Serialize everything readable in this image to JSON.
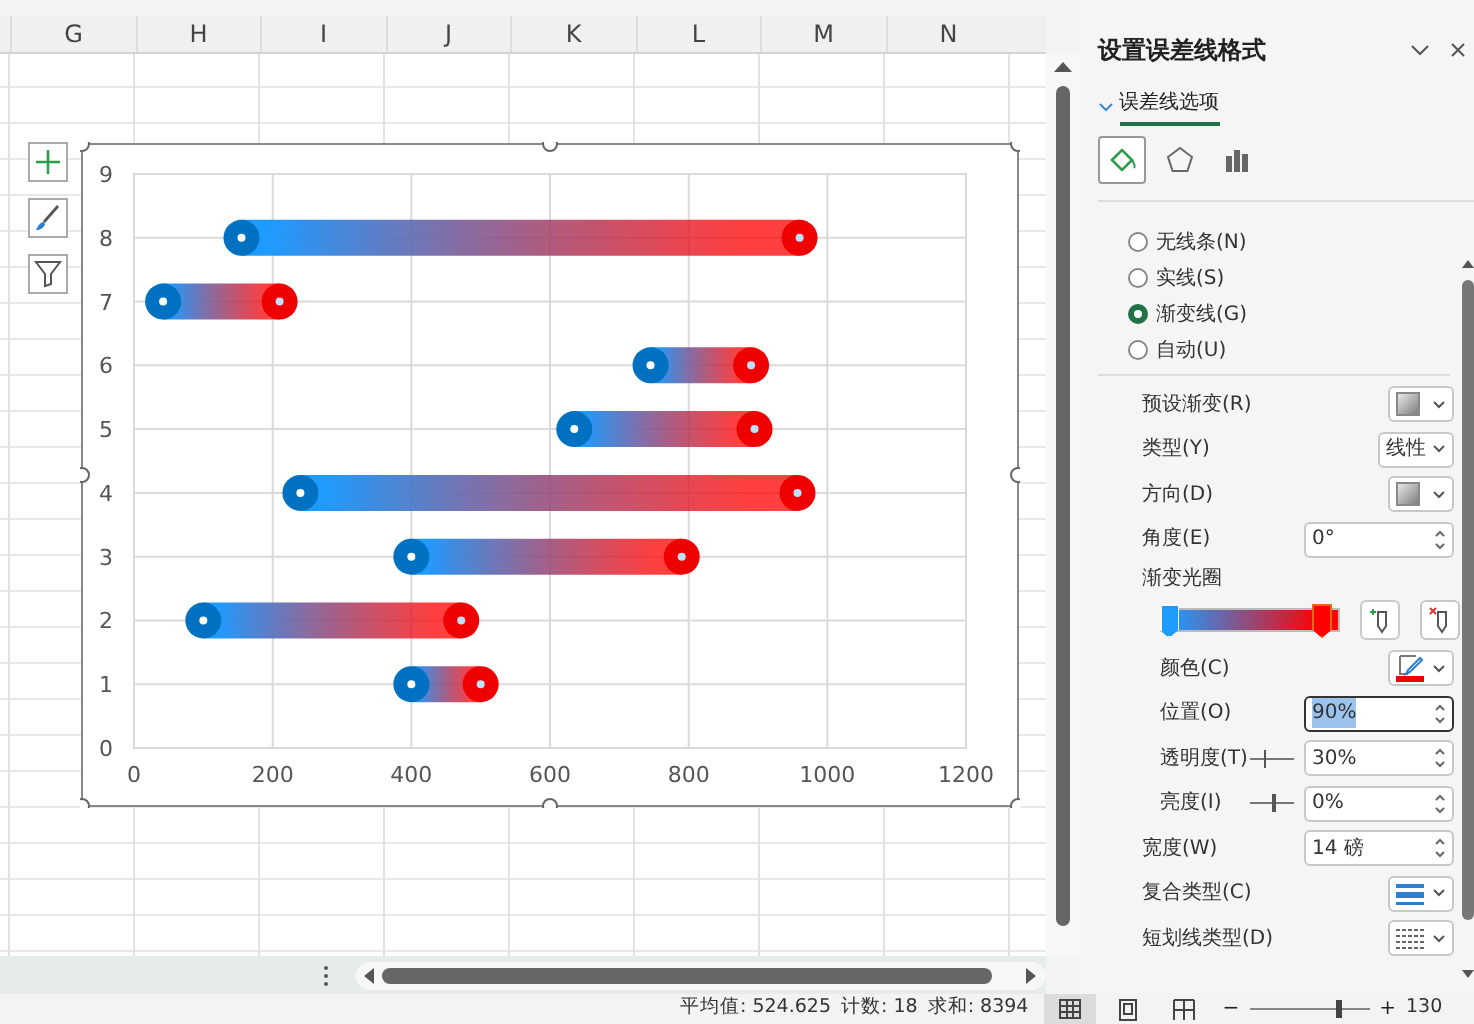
{
  "sheet": {
    "columns": [
      "G",
      "H",
      "I",
      "J",
      "K",
      "L",
      "M",
      "N"
    ]
  },
  "chart": {
    "chart_data": {
      "type": "scatter",
      "orientation": "horizontal",
      "grid": true,
      "x": [
        8,
        7,
        6,
        5,
        4,
        3,
        2,
        1
      ],
      "series": [
        {
          "color": "#0070c0",
          "values": [
            155,
            42,
            745,
            635,
            240,
            400,
            100,
            400
          ],
          "errors": [
            805,
            168,
            145,
            260,
            717,
            390,
            372,
            100
          ]
        },
        {
          "color": "#ee0000",
          "values": [
            960,
            210,
            890,
            895,
            957,
            790,
            472,
            500
          ]
        }
      ],
      "xlim": [
        0,
        1200
      ],
      "ylim": [
        0,
        9
      ],
      "xticks": [
        0,
        200,
        400,
        600,
        800,
        1000,
        1200
      ],
      "yticks": [
        0,
        1,
        2,
        3,
        4,
        5,
        6,
        7,
        8,
        9
      ]
    }
  },
  "pane": {
    "title": "设置误差线格式",
    "section": {
      "label": "误差线选项",
      "expanded": true
    },
    "icon_tabs": [
      {
        "kind": "fill",
        "selected": true
      },
      {
        "kind": "effects",
        "selected": false
      },
      {
        "kind": "options",
        "selected": false
      }
    ],
    "line_options": [
      {
        "label": "无线条(N)",
        "selected": false
      },
      {
        "label": "实线(S)",
        "selected": false
      },
      {
        "label": "渐变线(G)",
        "selected": true
      },
      {
        "label": "自动(U)",
        "selected": false
      }
    ],
    "rows": [
      {
        "kind": "swatch",
        "label": "预设渐变(R)"
      },
      {
        "kind": "select",
        "label": "类型(Y)",
        "value": "线性"
      },
      {
        "kind": "swatch",
        "label": "方向(D)"
      },
      {
        "kind": "spinner",
        "label": "角度(E)",
        "value": "0°",
        "selected": false
      },
      {
        "kind": "heading",
        "label": "渐变光圈",
        "children": [
          {
            "kind": "stops",
            "stops": [
              {
                "level": 0.05,
                "color": "#1e9bff",
                "selected": false
              },
              {
                "level": 0.9,
                "color": "#ff0000",
                "selected": true
              }
            ]
          },
          {
            "kind": "color",
            "label": "颜色(C)"
          },
          {
            "kind": "spinner",
            "label": "位置(O)",
            "value": "90%",
            "selected": true
          },
          {
            "kind": "slider",
            "label": "透明度(T)",
            "level": 0.3,
            "value": "30%"
          },
          {
            "kind": "slider",
            "label": "亮度(I)",
            "level": 0.5,
            "value": "0%"
          }
        ]
      },
      {
        "kind": "spinner",
        "label": "宽度(W)",
        "value": "14 磅",
        "selected": false
      },
      {
        "kind": "compound",
        "label": "复合类型(C)"
      },
      {
        "kind": "dash",
        "label": "短划线类型(D)"
      }
    ]
  },
  "status_bar": {
    "stats": [
      "平均值: 524.625",
      "计数: 18",
      "求和: 8394"
    ],
    "views": [
      {
        "kind": "normal",
        "selected": true
      },
      {
        "kind": "layout",
        "selected": false
      },
      {
        "kind": "pagebreak",
        "selected": false
      }
    ],
    "zoom": {
      "level": 0.73,
      "minus": "−",
      "plus": "+",
      "value": "130"
    }
  }
}
